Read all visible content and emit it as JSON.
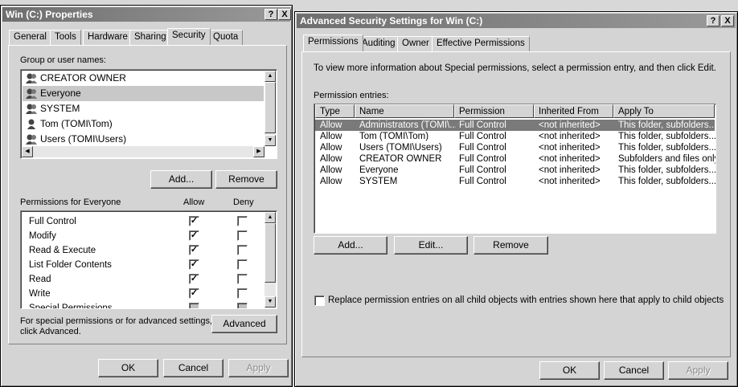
{
  "props": {
    "title": "Win (C:) Properties",
    "help_btn": "?",
    "close_btn": "X",
    "tabs": [
      "General",
      "Tools",
      "Hardware",
      "Sharing",
      "Security",
      "Quota"
    ],
    "group_label": "Group or user names:",
    "users": [
      "CREATOR OWNER",
      "Everyone",
      "SYSTEM",
      "Tom (TOMI\\Tom)",
      "Users (TOMI\\Users)"
    ],
    "add": "Add...",
    "remove": "Remove",
    "perm_header": "Permissions for Everyone",
    "allow": "Allow",
    "deny": "Deny",
    "perms": [
      {
        "name": "Full Control",
        "allow": true,
        "deny": false
      },
      {
        "name": "Modify",
        "allow": true,
        "deny": false
      },
      {
        "name": "Read & Execute",
        "allow": true,
        "deny": false
      },
      {
        "name": "List Folder Contents",
        "allow": true,
        "deny": false
      },
      {
        "name": "Read",
        "allow": true,
        "deny": false
      },
      {
        "name": "Write",
        "allow": true,
        "deny": false
      },
      {
        "name": "Special Permissions",
        "allow": false,
        "deny": false
      }
    ],
    "special_note_1": "For special permissions or for advanced settings,",
    "special_note_2": "click Advanced.",
    "advanced": "Advanced",
    "ok": "OK",
    "cancel": "Cancel",
    "apply": "Apply"
  },
  "adv": {
    "title": "Advanced Security Settings for Win (C:)",
    "help_btn": "?",
    "close_btn": "X",
    "tabs": [
      "Permissions",
      "Auditing",
      "Owner",
      "Effective Permissions"
    ],
    "info": "To view more information about Special permissions, select a permission entry, and then click Edit.",
    "entries_label": "Permission entries:",
    "columns": [
      "Type",
      "Name",
      "Permission",
      "Inherited From",
      "Apply To"
    ],
    "rows": [
      [
        "Allow",
        "Administrators (TOMI\\...",
        "Full Control",
        "<not inherited>",
        "This folder, subfolders..."
      ],
      [
        "Allow",
        "Tom (TOMI\\Tom)",
        "Full Control",
        "<not inherited>",
        "This folder, subfolders..."
      ],
      [
        "Allow",
        "Users (TOMI\\Users)",
        "Full Control",
        "<not inherited>",
        "This folder, subfolders..."
      ],
      [
        "Allow",
        "CREATOR OWNER",
        "Full Control",
        "<not inherited>",
        "Subfolders and files only"
      ],
      [
        "Allow",
        "Everyone",
        "Full Control",
        "<not inherited>",
        "This folder, subfolders..."
      ],
      [
        "Allow",
        "SYSTEM",
        "Full Control",
        "<not inherited>",
        "This folder, subfolders..."
      ]
    ],
    "add": "Add...",
    "edit": "Edit...",
    "remove": "Remove",
    "replace_label": "Replace permission entries on all child objects with entries shown here that apply to child objects",
    "ok": "OK",
    "cancel": "Cancel",
    "apply": "Apply"
  }
}
